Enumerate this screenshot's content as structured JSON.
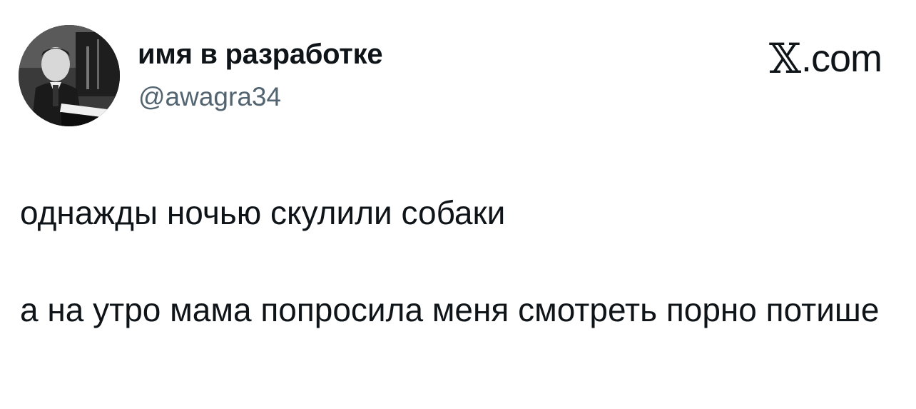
{
  "author": {
    "display_name": "имя в разработке",
    "handle": "@awagra34",
    "avatar_icon": "profile-photo"
  },
  "brand": {
    "logo_text": "𝕏",
    "suffix": ".com"
  },
  "tweet": {
    "paragraph_1": "однажды ночью скулили собаки",
    "paragraph_2": "а на утро мама попросила меня смотреть порно потише"
  },
  "colors": {
    "text_primary": "#0f1419",
    "text_secondary": "#536471",
    "background": "#ffffff"
  }
}
